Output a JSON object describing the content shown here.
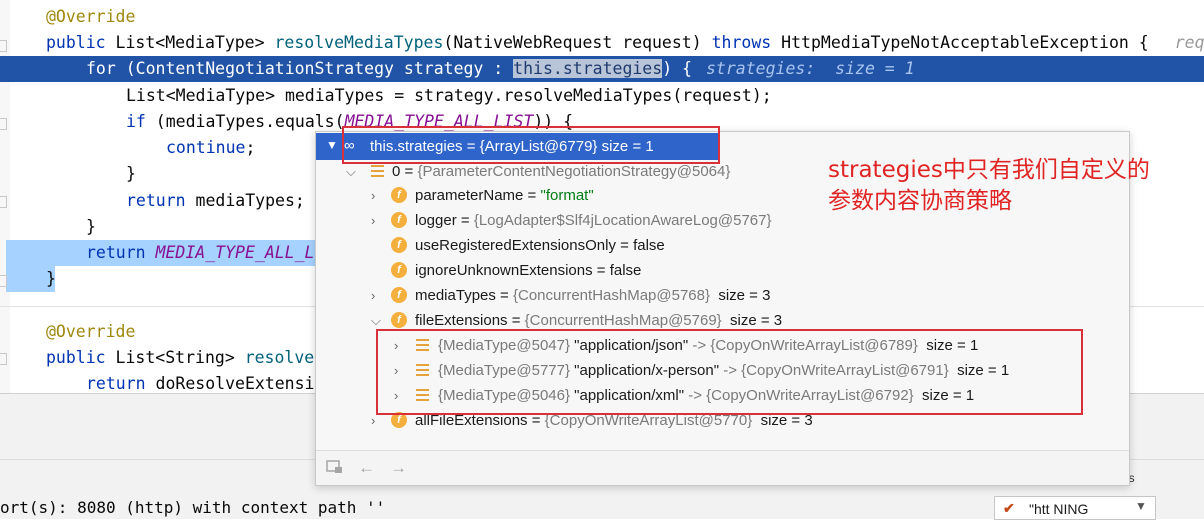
{
  "editor": {
    "line1": {
      "annotation": "@Override"
    },
    "line2": {
      "kw": "public",
      "t1": " List<MediaType> ",
      "method": "resolveMediaTypes",
      "t2": "(NativeWebRequest request) ",
      "kw2": "throws",
      "t3": " HttpMediaTypeNotAcceptableException {",
      "trail": "req"
    },
    "line3": {
      "kw": "for",
      "t1": " (ContentNegotiationStrategy strategy : ",
      "sel": "this.strategies",
      "t2": ") {",
      "hint": "strategies:  size = 1"
    },
    "line4": {
      "t1": "List<MediaType> mediaTypes = strategy.resolveMediaTypes(request);"
    },
    "line5": {
      "kw": "if",
      "t1": " (mediaTypes.equals(",
      "const": "MEDIA_TYPE_ALL_LIST",
      "t2": ")) {"
    },
    "line6": {
      "kw": "continue",
      "t1": ";"
    },
    "line7": {
      "t1": "}"
    },
    "line8": {
      "kw": "return",
      "t1": " mediaTypes;"
    },
    "line9": {
      "t1": "}"
    },
    "line10": {
      "kw": "return",
      "const": "MEDIA_TYPE_ALL_L"
    },
    "line11": {
      "t1": "}"
    },
    "line12": {
      "annotation": "@Override"
    },
    "line13": {
      "kw": "public",
      "t1": " List<String> ",
      "method": "resolve"
    },
    "line14": {
      "kw": "return",
      "t1": " doResolveExtensi"
    }
  },
  "debug_popup": {
    "root": "this.strategies = {ArrayList@6779}  size = 1",
    "item0": {
      "index": "0",
      "eq": " = ",
      "value": "{ParameterContentNegotiationStrategy@5064}"
    },
    "fields": [
      {
        "name": "parameterName",
        "eq": " = ",
        "value": "\"format\"",
        "value_type": "string"
      },
      {
        "name": "logger",
        "eq": " = ",
        "value": "{LogAdapter$Slf4jLocationAwareLog@5767}",
        "value_type": "object"
      },
      {
        "name": "useRegisteredExtensionsOnly",
        "eq": " = ",
        "value": "false",
        "value_type": "plain"
      },
      {
        "name": "ignoreUnknownExtensions",
        "eq": " = ",
        "value": "false",
        "value_type": "plain"
      },
      {
        "name": "mediaTypes",
        "eq": " = ",
        "value": "{ConcurrentHashMap@5768}",
        "size": "size = 3",
        "value_type": "object"
      },
      {
        "name": "fileExtensions",
        "eq": " = ",
        "value": "{ConcurrentHashMap@5769}",
        "size": "size = 3",
        "value_type": "object"
      }
    ],
    "entries": [
      {
        "key": "{MediaType@5047}",
        "str": "\"application/json\"",
        "arrow": " -> ",
        "value": "{CopyOnWriteArrayList@6789}",
        "size": "size = 1"
      },
      {
        "key": "{MediaType@5777}",
        "str": "\"application/x-person\"",
        "arrow": " -> ",
        "value": "{CopyOnWriteArrayList@6791}",
        "size": "size = 1"
      },
      {
        "key": "{MediaType@5046}",
        "str": "\"application/xml\"",
        "arrow": " -> ",
        "value": "{CopyOnWriteArrayList@6792}",
        "size": "size = 1"
      }
    ],
    "last_field": {
      "name": "allFileExtensions",
      "eq": " = ",
      "value": "{CopyOnWriteArrayList@5770}",
      "size": "size = 3"
    },
    "toolbar": {
      "back_icon": "←",
      "forward_icon": "→"
    }
  },
  "annotation_note": {
    "line1": "strategies中只有我们自定义的",
    "line2": "参数内容协商策略"
  },
  "console": {
    "text": "ort(s): 8080 (http) with context path ''",
    "es_label": "es",
    "dropdown_value": "\"htt  NING"
  },
  "colors": {
    "highlight_line": "#2154a6",
    "selection": "#a6d2ff",
    "popup_root": "#2f65ca",
    "annotation_red": "#e02424",
    "field_icon": "#f4af3d"
  }
}
